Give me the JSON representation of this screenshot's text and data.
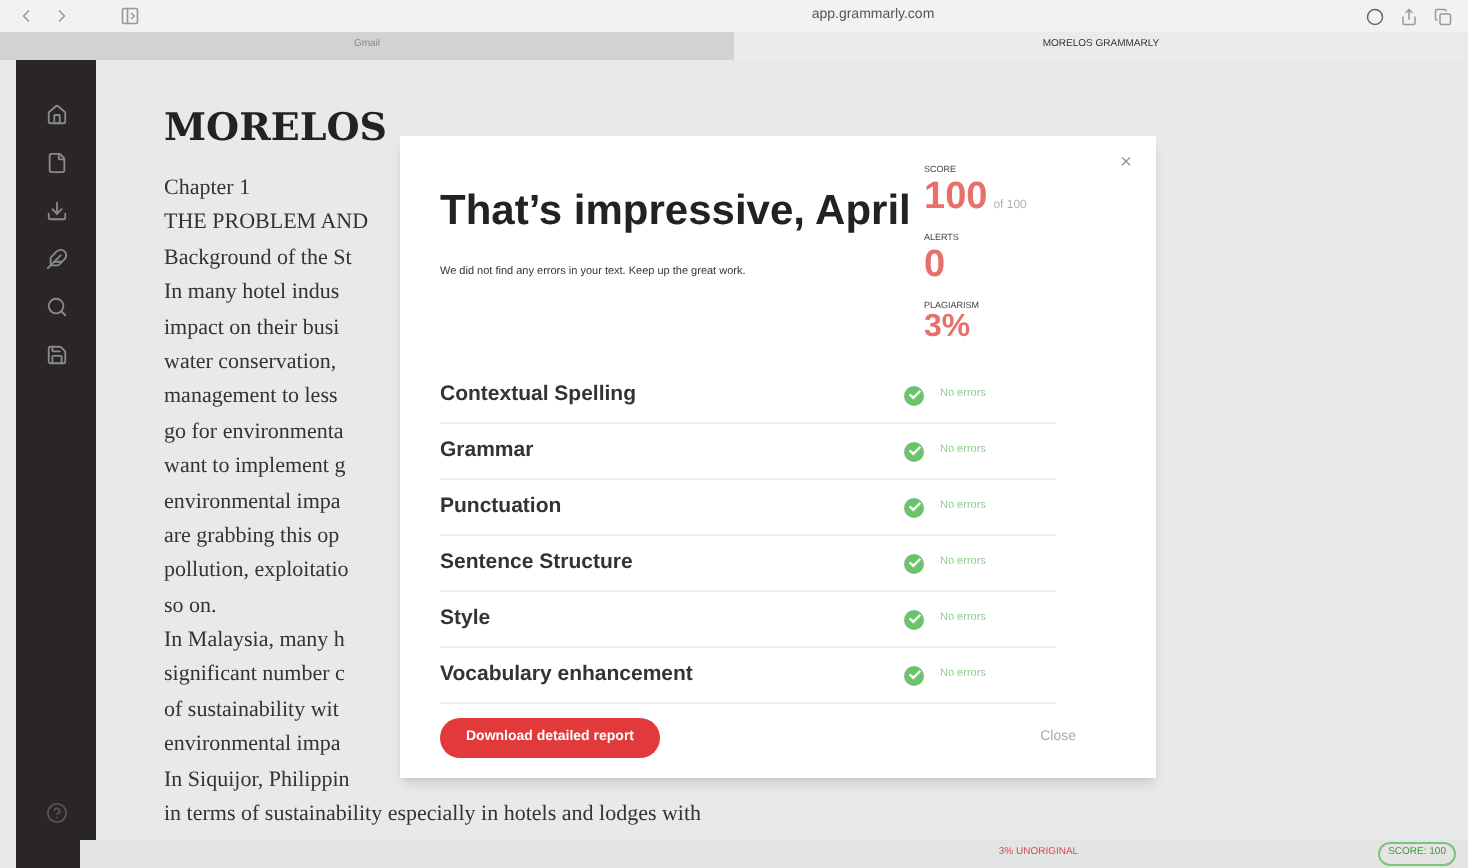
{
  "browser": {
    "url": "app.grammarly.com",
    "tabs": [
      {
        "label": "Gmail",
        "selected": false
      },
      {
        "label": "MORELOS GRAMMARLY",
        "selected": true
      }
    ]
  },
  "document": {
    "title": "MORELOS",
    "lines": [
      "Chapter 1",
      "THE PROBLEM AND",
      "Background of the St",
      "In many hotel indus",
      "impact on their busi",
      "water conservation,",
      "management to less",
      "go for environmenta",
      "want to implement g",
      "environmental impa",
      "are grabbing this op",
      "pollution, exploitatio",
      "so on.",
      "In Malaysia, many h",
      "significant number c",
      "of sustainability wit",
      "environmental impa",
      "In Siquijor, Philippin",
      "in terms of sustainability especially in hotels and lodges with"
    ]
  },
  "dialog": {
    "title": "That’s impressive, April",
    "message": "We did not find any errors in your text. Keep up the great work.",
    "score": {
      "label": "SCORE",
      "value": "100",
      "suffix": "of 100"
    },
    "alerts": {
      "label": "ALERTS",
      "value": "0"
    },
    "plagiarism": {
      "label": "PLAGIARISM",
      "value": "3%"
    },
    "checks": [
      {
        "name": "Contextual Spelling",
        "result": "No errors",
        "passed": true
      },
      {
        "name": "Grammar",
        "result": "No errors",
        "passed": true
      },
      {
        "name": "Punctuation",
        "result": "No errors",
        "passed": true
      },
      {
        "name": "Sentence Structure",
        "result": "No errors",
        "passed": true
      },
      {
        "name": "Style",
        "result": "No errors",
        "passed": true
      },
      {
        "name": "Vocabulary enhancement",
        "result": "No errors",
        "passed": true
      }
    ],
    "download_button": "Download detailed report",
    "close_button": "Close",
    "close_icon": "×"
  },
  "status_bar": {
    "unoriginal": "3% UNORIGINAL",
    "score": "SCORE: 100"
  }
}
